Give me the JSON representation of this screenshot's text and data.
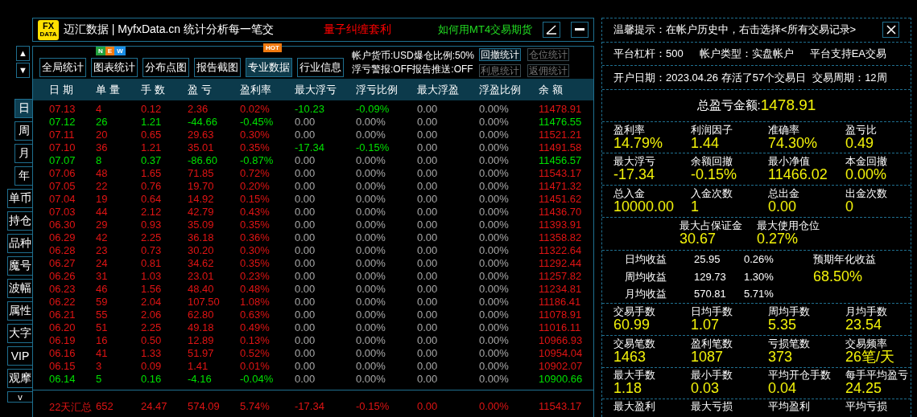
{
  "title_bar": {
    "logo": [
      "FX",
      "DATA"
    ],
    "title": "迈汇数据 | MyfxData.cn  统计分析每一笔交",
    "links": [
      {
        "label": "量子纠缠套利",
        "color": "#ff0000"
      },
      {
        "label": "如何用MT4交易期货",
        "color": "#22dd22"
      }
    ]
  },
  "nav": {
    "arrows": [
      "▲",
      "▼"
    ],
    "periods": [
      {
        "label": "日",
        "selected": true
      },
      {
        "label": "周",
        "selected": false
      },
      {
        "label": "月",
        "selected": false
      },
      {
        "label": "年",
        "selected": false
      }
    ],
    "tools": [
      "单币",
      "持仓",
      "品种",
      "魔号",
      "波幅",
      "属性",
      "大字",
      "VIP",
      "观摩",
      "v"
    ]
  },
  "toolbar": {
    "tabs": [
      {
        "label": "全局统计",
        "selected": false
      },
      {
        "label": "图表统计",
        "selected": false,
        "badge": {
          "kind": "new",
          "letters": [
            "N",
            "E",
            "W"
          ]
        }
      },
      {
        "label": "分布点图",
        "selected": false
      },
      {
        "label": "报告截图",
        "selected": false
      },
      {
        "label": "专业数据",
        "selected": true,
        "badge": {
          "kind": "hot",
          "letters": [
            "HOT"
          ]
        }
      },
      {
        "label": "行业信息",
        "selected": false
      }
    ],
    "info": [
      "帐户货币:USD爆仓比例:50%",
      "浮亏警报:OFF报告推送:OFF"
    ],
    "stat_buttons": [
      {
        "label": "回撤统计",
        "disabled": false
      },
      {
        "label": "仓位统计",
        "disabled": true
      },
      {
        "label": "利息统计",
        "disabled": true
      },
      {
        "label": "返佣统计",
        "disabled": true
      }
    ]
  },
  "table": {
    "columns": [
      "日 期",
      "单 量",
      "手 数",
      "盈 亏",
      "盈利率",
      "最大浮亏",
      "浮亏比例",
      "最大浮盈",
      "浮盈比例",
      "余 额"
    ],
    "rows": [
      {
        "cells": [
          "07.13",
          "4",
          "0.12",
          "2.36",
          "0.02%",
          "-10.23",
          "-0.09%",
          "0.00",
          "0.00%",
          "11478.91"
        ],
        "loss": false,
        "float_loss": true,
        "balance_down": false
      },
      {
        "cells": [
          "07.12",
          "26",
          "1.21",
          "-44.66",
          "-0.45%",
          "0.00",
          "0.00%",
          "0.00",
          "0.00%",
          "11476.55"
        ],
        "loss": true,
        "float_loss": false,
        "balance_down": true
      },
      {
        "cells": [
          "07.11",
          "20",
          "0.65",
          "29.63",
          "0.30%",
          "0.00",
          "0.00%",
          "0.00",
          "0.00%",
          "11521.21"
        ],
        "loss": false,
        "float_loss": false,
        "balance_down": false
      },
      {
        "cells": [
          "07.10",
          "36",
          "1.21",
          "35.01",
          "0.35%",
          "-17.34",
          "-0.15%",
          "0.00",
          "0.00%",
          "11491.58"
        ],
        "loss": false,
        "float_loss": true,
        "balance_down": false
      },
      {
        "cells": [
          "07.07",
          "8",
          "0.37",
          "-86.60",
          "-0.87%",
          "0.00",
          "0.00%",
          "0.00",
          "0.00%",
          "11456.57"
        ],
        "loss": true,
        "float_loss": false,
        "balance_down": true
      },
      {
        "cells": [
          "07.06",
          "48",
          "1.65",
          "71.85",
          "0.72%",
          "0.00",
          "0.00%",
          "0.00",
          "0.00%",
          "11543.17"
        ],
        "loss": false,
        "float_loss": false,
        "balance_down": false
      },
      {
        "cells": [
          "07.05",
          "22",
          "0.76",
          "19.70",
          "0.20%",
          "0.00",
          "0.00%",
          "0.00",
          "0.00%",
          "11471.32"
        ],
        "loss": false,
        "float_loss": false,
        "balance_down": false
      },
      {
        "cells": [
          "07.04",
          "19",
          "0.64",
          "14.92",
          "0.15%",
          "0.00",
          "0.00%",
          "0.00",
          "0.00%",
          "11451.62"
        ],
        "loss": false,
        "float_loss": false,
        "balance_down": false
      },
      {
        "cells": [
          "07.03",
          "44",
          "2.12",
          "42.79",
          "0.43%",
          "0.00",
          "0.00%",
          "0.00",
          "0.00%",
          "11436.70"
        ],
        "loss": false,
        "float_loss": false,
        "balance_down": false
      },
      {
        "cells": [
          "06.30",
          "29",
          "0.93",
          "35.09",
          "0.35%",
          "0.00",
          "0.00%",
          "0.00",
          "0.00%",
          "11393.91"
        ],
        "loss": false,
        "float_loss": false,
        "balance_down": false
      },
      {
        "cells": [
          "06.29",
          "42",
          "2.25",
          "36.18",
          "0.36%",
          "0.00",
          "0.00%",
          "0.00",
          "0.00%",
          "11358.82"
        ],
        "loss": false,
        "float_loss": false,
        "balance_down": false
      },
      {
        "cells": [
          "06.28",
          "23",
          "0.73",
          "30.20",
          "0.30%",
          "0.00",
          "0.00%",
          "0.00",
          "0.00%",
          "11322.64"
        ],
        "loss": false,
        "float_loss": false,
        "balance_down": false
      },
      {
        "cells": [
          "06.27",
          "24",
          "0.81",
          "34.62",
          "0.35%",
          "0.00",
          "0.00%",
          "0.00",
          "0.00%",
          "11292.44"
        ],
        "loss": false,
        "float_loss": false,
        "balance_down": false
      },
      {
        "cells": [
          "06.26",
          "31",
          "1.03",
          "23.01",
          "0.23%",
          "0.00",
          "0.00%",
          "0.00",
          "0.00%",
          "11257.82"
        ],
        "loss": false,
        "float_loss": false,
        "balance_down": false
      },
      {
        "cells": [
          "06.23",
          "46",
          "1.56",
          "48.40",
          "0.48%",
          "0.00",
          "0.00%",
          "0.00",
          "0.00%",
          "11234.81"
        ],
        "loss": false,
        "float_loss": false,
        "balance_down": false
      },
      {
        "cells": [
          "06.22",
          "59",
          "2.04",
          "107.50",
          "1.08%",
          "0.00",
          "0.00%",
          "0.00",
          "0.00%",
          "11186.41"
        ],
        "loss": false,
        "float_loss": false,
        "balance_down": false
      },
      {
        "cells": [
          "06.21",
          "55",
          "2.06",
          "62.80",
          "0.63%",
          "0.00",
          "0.00%",
          "0.00",
          "0.00%",
          "11078.91"
        ],
        "loss": false,
        "float_loss": false,
        "balance_down": false
      },
      {
        "cells": [
          "06.20",
          "51",
          "2.25",
          "49.18",
          "0.49%",
          "0.00",
          "0.00%",
          "0.00",
          "0.00%",
          "11016.11"
        ],
        "loss": false,
        "float_loss": false,
        "balance_down": false
      },
      {
        "cells": [
          "06.19",
          "16",
          "0.50",
          "12.89",
          "0.13%",
          "0.00",
          "0.00%",
          "0.00",
          "0.00%",
          "10966.93"
        ],
        "loss": false,
        "float_loss": false,
        "balance_down": false
      },
      {
        "cells": [
          "06.16",
          "41",
          "1.33",
          "51.97",
          "0.52%",
          "0.00",
          "0.00%",
          "0.00",
          "0.00%",
          "10954.04"
        ],
        "loss": false,
        "float_loss": false,
        "balance_down": false
      },
      {
        "cells": [
          "06.15",
          "3",
          "0.09",
          "1.41",
          "0.01%",
          "0.00",
          "0.00%",
          "0.00",
          "0.00%",
          "10902.07"
        ],
        "loss": false,
        "float_loss": false,
        "balance_down": false
      },
      {
        "cells": [
          "06.14",
          "5",
          "0.16",
          "-4.16",
          "-0.04%",
          "0.00",
          "0.00%",
          "0.00",
          "0.00%",
          "10900.66"
        ],
        "loss": true,
        "float_loss": false,
        "balance_down": true
      }
    ],
    "summary": [
      "22天汇总",
      "652",
      "24.47",
      "574.09",
      "5.74%",
      "-17.34",
      "-0.15%",
      "0.00",
      "0.00%",
      "11543.17"
    ]
  },
  "side": {
    "tip": "温馨提示：在帐户历史中，右击选择<所有交易记录>",
    "account": [
      "平台杠杆：500",
      "帐户类型：实盘帐户",
      "平台支持EA交易"
    ],
    "history": [
      "开户日期：2023.04.26 存活了57个交易日",
      "交易周期：12周"
    ],
    "total": {
      "label": "总盈亏金额:",
      "value": "1478.91"
    },
    "sections": [
      {
        "kind": "grid",
        "items": [
          {
            "label": "盈利率",
            "value": "14.79%"
          },
          {
            "label": "利润因子",
            "value": "1.44"
          },
          {
            "label": "准确率",
            "value": "74.30%"
          },
          {
            "label": "盈亏比",
            "value": "0.49"
          }
        ]
      },
      {
        "kind": "grid",
        "items": [
          {
            "label": "最大浮亏",
            "value": "-17.34"
          },
          {
            "label": "余额回撤",
            "value": "-0.15%"
          },
          {
            "label": "最小净值",
            "value": "11466.02"
          },
          {
            "label": "本金回撤",
            "value": "0.00%"
          }
        ]
      },
      {
        "kind": "grid",
        "items": [
          {
            "label": "总入金",
            "value": "10000.00"
          },
          {
            "label": "入金次数",
            "value": "1"
          },
          {
            "label": "总出金",
            "value": "0.00"
          },
          {
            "label": "出金次数",
            "value": "0"
          }
        ]
      },
      {
        "kind": "pair",
        "items": [
          {
            "label": "最大占保证金",
            "value": "30.67"
          },
          {
            "label": "最大使用仓位",
            "value": "0.27%"
          }
        ]
      },
      {
        "kind": "averages",
        "rows": [
          [
            "日均收益",
            "25.95",
            "0.26%"
          ],
          [
            "周均收益",
            "129.73",
            "1.30%"
          ],
          [
            "月均收益",
            "570.81",
            "5.71%"
          ]
        ],
        "annual": {
          "label": "预期年化收益",
          "value": "68.50%"
        }
      },
      {
        "kind": "grid",
        "items": [
          {
            "label": "交易手数",
            "value": "60.99"
          },
          {
            "label": "日均手数",
            "value": "1.07"
          },
          {
            "label": "周均手数",
            "value": "5.35"
          },
          {
            "label": "月均手数",
            "value": "23.54"
          }
        ]
      },
      {
        "kind": "grid",
        "items": [
          {
            "label": "交易笔数",
            "value": "1463"
          },
          {
            "label": "盈利笔数",
            "value": "1087"
          },
          {
            "label": "亏损笔数",
            "value": "373"
          },
          {
            "label": "交易频率",
            "value": "26笔/天"
          }
        ]
      },
      {
        "kind": "grid",
        "items": [
          {
            "label": "最大手数",
            "value": "1.18"
          },
          {
            "label": "最小手数",
            "value": "0.03"
          },
          {
            "label": "平均开仓手数",
            "value": "0.04"
          },
          {
            "label": "每手平均盈亏",
            "value": "24.25"
          }
        ]
      },
      {
        "kind": "grid",
        "items": [
          {
            "label": "最大盈利"
          },
          {
            "label": "最大亏损"
          },
          {
            "label": "平均盈利"
          },
          {
            "label": "平均亏损"
          }
        ]
      }
    ]
  }
}
